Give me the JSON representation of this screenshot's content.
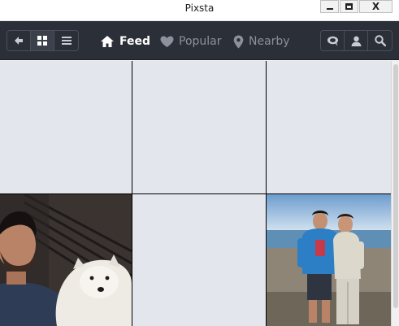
{
  "window": {
    "title": "Pixsta",
    "close_label": "X"
  },
  "toolbar": {
    "nav": [
      {
        "label": "Feed",
        "icon": "home-icon",
        "active": true
      },
      {
        "label": "Popular",
        "icon": "heart-icon",
        "active": false
      },
      {
        "label": "Nearby",
        "icon": "map-pin-icon",
        "active": false
      }
    ],
    "left_buttons": [
      "back-arrow-icon",
      "grid-view-icon",
      "list-view-icon"
    ],
    "right_buttons": [
      "chat-bubble-icon",
      "user-icon",
      "search-icon"
    ]
  },
  "grid": {
    "photos": [
      {
        "content": "empty"
      },
      {
        "content": "empty"
      },
      {
        "content": "empty"
      },
      {
        "content": "photo",
        "icon": "photo-man-with-white-dog"
      },
      {
        "content": "empty"
      },
      {
        "content": "photo",
        "icon": "photo-two-men-on-beach"
      }
    ]
  },
  "colors": {
    "toolbar_bg": "#2b2f38",
    "nav_active": "#ffffff",
    "nav_inactive": "#8c919b",
    "cell_placeholder": "#e3e6ec"
  }
}
